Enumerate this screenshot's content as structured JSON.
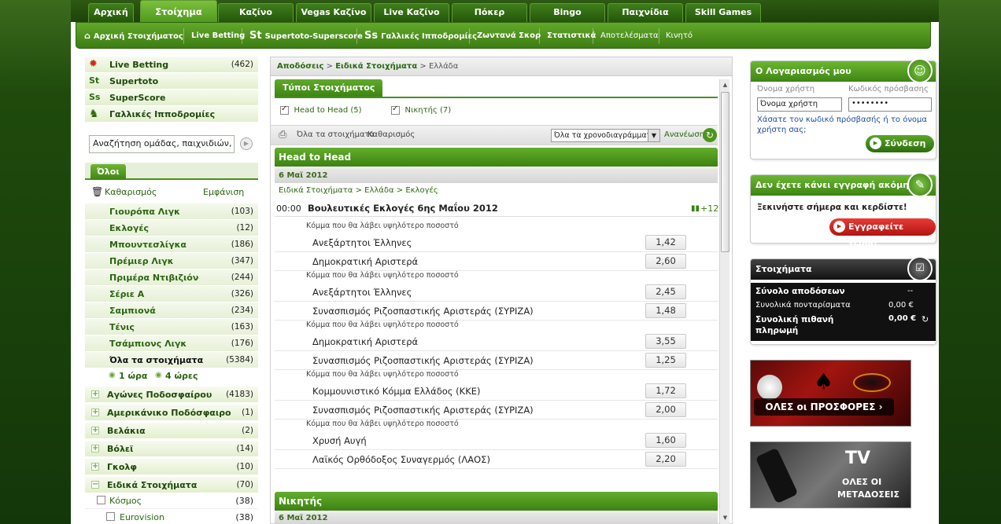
{
  "top_tabs": [
    "Αρχική",
    "Στοίχημα",
    "Καζίνο",
    "Vegas Καζίνο",
    "Live Καζίνο",
    "Πόκερ",
    "Bingo",
    "Παιχνίδια",
    "Skill Games"
  ],
  "sub_nav": [
    "Αρχική Στοιχήματος",
    "Live Betting",
    "Supertoto-Superscore",
    "Γαλλικές Ιπποδρομίες",
    "Ζωντανά Σκορ",
    "Στατιστικά",
    "Αποτελέσματα",
    "Κινητό"
  ],
  "left": {
    "top_items": [
      {
        "label": "Live Betting",
        "count": "(462)",
        "icon": "live-betting-icon"
      },
      {
        "label": "Supertoto",
        "count": "",
        "icon": "supertoto-icon"
      },
      {
        "label": "SuperScore",
        "count": "",
        "icon": "superscore-icon"
      },
      {
        "label": "Γαλλικές Ιπποδρομίες",
        "count": "",
        "icon": "horse-icon"
      }
    ],
    "search_value": "Αναζήτηση ομάδας, παιχνιδιών, γεγ",
    "tab_all": "Όλοι",
    "clear_label": "Καθαρισμός",
    "show_label": "Εμφάνιση",
    "leagues": [
      {
        "label": "Γιουρόπα Λιγκ",
        "count": "(103)"
      },
      {
        "label": "Εκλογές",
        "count": "(12)"
      },
      {
        "label": "Μπουντεσλίγκα",
        "count": "(186)"
      },
      {
        "label": "Πρέμιερ Λιγκ",
        "count": "(347)"
      },
      {
        "label": "Πριμέρα Ντιβιζιόν",
        "count": "(244)"
      },
      {
        "label": "Σέριε Α",
        "count": "(326)"
      },
      {
        "label": "Σαμπιονά",
        "count": "(234)"
      },
      {
        "label": "Τένις",
        "count": "(163)"
      },
      {
        "label": "Τσάμπιονς Λιγκ",
        "count": "(176)"
      },
      {
        "label": "Όλα τα στοιχήματα",
        "count": "(5384)"
      }
    ],
    "time_1": "1 ώρα",
    "time_4": "4 ώρες",
    "sports": [
      {
        "label": "Αγώνες Ποδοσφαίρου",
        "count": "(4183)"
      },
      {
        "label": "Αμερικάνικο Ποδόσφαιρο",
        "count": "(1)"
      },
      {
        "label": "Βελάκια",
        "count": "(2)"
      },
      {
        "label": "Βόλεϊ",
        "count": "(14)"
      },
      {
        "label": "Γκολφ",
        "count": "(10)"
      },
      {
        "label": "Ειδικά Στοιχήματα",
        "count": "(70)"
      }
    ],
    "sub_sports": [
      {
        "label": "Κόσμος",
        "count": "(38)"
      },
      {
        "label": "Eurovision",
        "count": "(38)"
      }
    ]
  },
  "mid": {
    "crumb": [
      "Αποδόσεις",
      "Ειδικά Στοιχήματα",
      "Ελλάδα"
    ],
    "bet_types_tab": "Τύποι Στοιχήματος",
    "filters": [
      {
        "label": "Head to Head (5)"
      },
      {
        "label": "Νικητής (7)"
      }
    ],
    "all_bets": "Όλα τα στοιχήματα",
    "clear": "Καθαρισμός",
    "timeframe": "Όλα τα χρονοδιαγράμματ",
    "refresh": "Ανανέωση",
    "group1": "Head to Head",
    "date1": "6 Μαϊ 2012",
    "sub_crumb": "Ειδικά Στοιχήματα > Ελλάδα > Εκλογές",
    "event_time": "00:00",
    "event_name": "Βουλευτικές Εκλογές 6ης Μαΐου 2012",
    "more": "+12",
    "market_label": "Κόμμα που θα λάβει υψηλότερο ποσοστό",
    "markets": [
      [
        {
          "name": "Ανεξάρτητοι Έλληνες",
          "odd": "1,42"
        },
        {
          "name": "Δημοκρατική Αριστερά",
          "odd": "2,60"
        }
      ],
      [
        {
          "name": "Ανεξάρτητοι Έλληνες",
          "odd": "2,45"
        },
        {
          "name": "Συνασπισμός Ριζοσπαστικής Αριστεράς (ΣΥΡΙΖΑ)",
          "odd": "1,48"
        }
      ],
      [
        {
          "name": "Δημοκρατική Αριστερά",
          "odd": "3,55"
        },
        {
          "name": "Συνασπισμός Ριζοσπαστικής Αριστεράς (ΣΥΡΙΖΑ)",
          "odd": "1,25"
        }
      ],
      [
        {
          "name": "Κομμουνιστικό Κόμμα Ελλάδος (ΚΚΕ)",
          "odd": "1,72"
        },
        {
          "name": "Συνασπισμός Ριζοσπαστικής Αριστεράς (ΣΥΡΙΖΑ)",
          "odd": "2,00"
        }
      ],
      [
        {
          "name": "Χρυσή Αυγή",
          "odd": "1,60"
        },
        {
          "name": "Λαϊκός Ορθόδοξος Συναγερμός (ΛΑΟΣ)",
          "odd": "2,20"
        }
      ]
    ],
    "group2": "Νικητής",
    "date2": "6 Μαϊ 2012"
  },
  "account": {
    "title": "Ο Λογαριασμός μου",
    "user_label": "Όνομα χρήστη",
    "pass_label": "Κωδικός πρόσβασης",
    "user_value": "Όνομα χρήστη",
    "pass_value": "••••••••",
    "forgot": "Χάσατε τον κωδικό πρόσβασής ή το όνομα χρήστη σας;",
    "login": "Σύνδεση"
  },
  "register": {
    "title": "Δεν έχετε κάνει εγγραφή ακόμη;",
    "text": "Ξεκινήστε σήμερα και κερδίστε!",
    "button": "Εγγραφείτε τώρα!"
  },
  "betslip": {
    "title": "Στοιχήματα",
    "total_odds_label": "Σύνολο αποδόσεων",
    "total_odds_value": "--",
    "total_stake_label": "Συνολικά πονταρίσματα",
    "total_stake_value": "0,00 €",
    "total_win_label": "Συνολική πιθανή πληρωμή",
    "total_win_value": "0,00 €"
  },
  "promos": {
    "offers_a": "ΟΛΕΣ",
    "offers_b": "οι ΠΡΟΣΦΟΡΕΣ",
    "tv_title": "TV",
    "tv_a": "ΟΛΕΣ ΟΙ",
    "tv_b": "ΜΕΤΑΔΟΣΕΙΣ"
  },
  "colors": {
    "brand_green": "#3e8513",
    "accent_red": "#c41f1a"
  }
}
